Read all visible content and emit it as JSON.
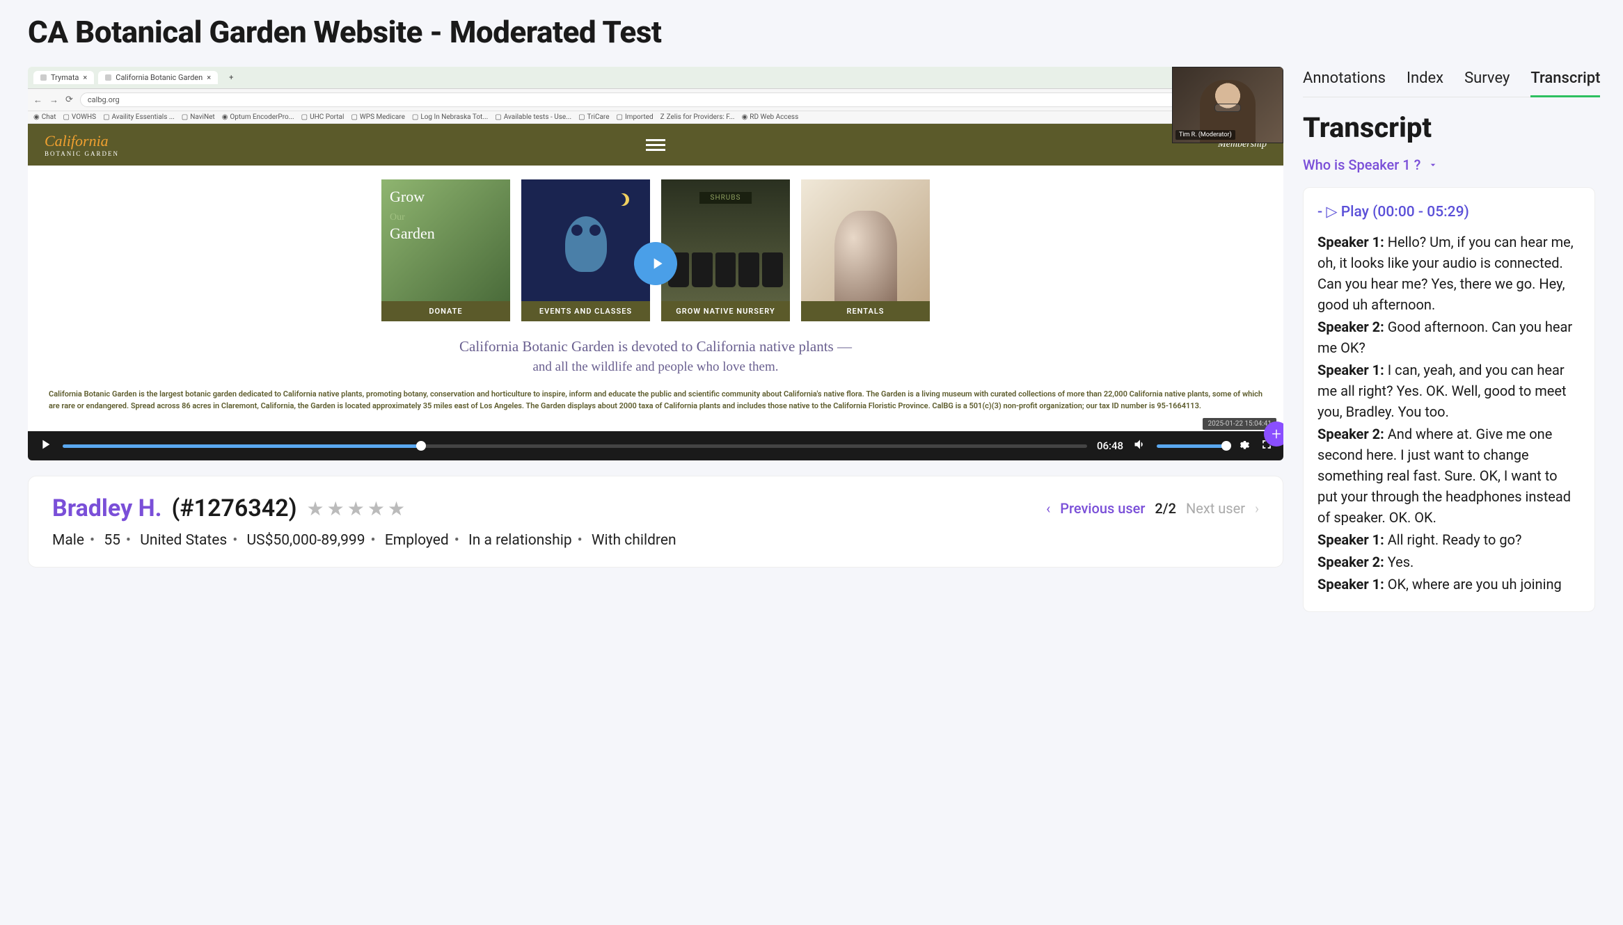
{
  "page_title": "CA Botanical Garden Website - Moderated Test",
  "browser": {
    "tabs": [
      "Trymata",
      "California Botanic Garden"
    ],
    "url": "calbg.org",
    "bookmarks": [
      "Chat",
      "VOWHS",
      "Availity Essentials ...",
      "NaviNet",
      "Optum EncoderPro...",
      "UHC Portal",
      "WPS Medicare",
      "Log In Nebraska Tot...",
      "Available tests - Use...",
      "TriCare",
      "Imported",
      "Zelis for Providers: F...",
      "RD Web Access"
    ]
  },
  "site": {
    "logo_main": "California",
    "logo_sub": "BOTANIC GARDEN",
    "nav_right": "Membership",
    "cards": [
      {
        "overlay_line1": "Grow",
        "overlay_line2": "Our",
        "overlay_line3": "Garden",
        "label": "DONATE"
      },
      {
        "label": "EVENTS AND CLASSES"
      },
      {
        "sign": "SHRUBS",
        "label": "GROW NATIVE NURSERY"
      },
      {
        "label": "RENTALS"
      }
    ],
    "tagline1": "California Botanic Garden is devoted to California native plants —",
    "tagline2": "and all the wildlife and people who love them.",
    "paragraph": "California Botanic Garden is the largest botanic garden dedicated to California native plants, promoting botany, conservation and horticulture to inspire, inform and educate the public and scientific community about California's native flora. The Garden is a living museum with curated collections of more than 22,000 California native plants, some of which are rare or endangered. Spread across 86 acres in Claremont, California, the Garden is located approximately 35 miles east of Los Angeles. The Garden displays about 2000 taxa of California plants and includes those native to the California Floristic Province. CalBG is a 501(c)(3) non-profit organization; our tax ID number is 95-1664113."
  },
  "webcam_label": "Tim R. (Moderator)",
  "player": {
    "time": "06:48",
    "timestamp": "2025-01-22 15:04:41"
  },
  "user": {
    "name": "Bradley H.",
    "id": "(#1276342)",
    "rating": 0,
    "prev_label": "Previous user",
    "page": "2/2",
    "next_label": "Next user",
    "meta": [
      "Male",
      "55",
      "United States",
      "US$50,000-89,999",
      "Employed",
      "In a relationship",
      "With children"
    ]
  },
  "tabs": [
    "Annotations",
    "Index",
    "Survey",
    "Transcript"
  ],
  "active_tab": "Transcript",
  "right_title": "Transcript",
  "speaker_filter": "Who is Speaker 1 ?",
  "play_link": "- ▷ Play (00:00 - 05:29)",
  "transcript": [
    {
      "speaker": "Speaker 1:",
      "text": " Hello? Um, if you can hear me, oh, it looks like your audio is connected. Can you hear me? Yes, there we go. Hey, good uh afternoon."
    },
    {
      "speaker": "Speaker 2:",
      "text": " Good afternoon. Can you hear me OK?"
    },
    {
      "speaker": "Speaker 1:",
      "text": " I can, yeah, and you can hear me all right? Yes. OK. Well, good to meet you, Bradley. You too."
    },
    {
      "speaker": "Speaker 2:",
      "text": " And where at. Give me one second here. I just want to change something real fast. Sure. OK, I want to put your through the headphones instead of speaker. OK. OK."
    },
    {
      "speaker": "Speaker 1:",
      "text": " All right. Ready to go?"
    },
    {
      "speaker": "Speaker 2:",
      "text": " Yes."
    },
    {
      "speaker": "Speaker 1:",
      "text": " OK, where are you uh joining"
    }
  ]
}
